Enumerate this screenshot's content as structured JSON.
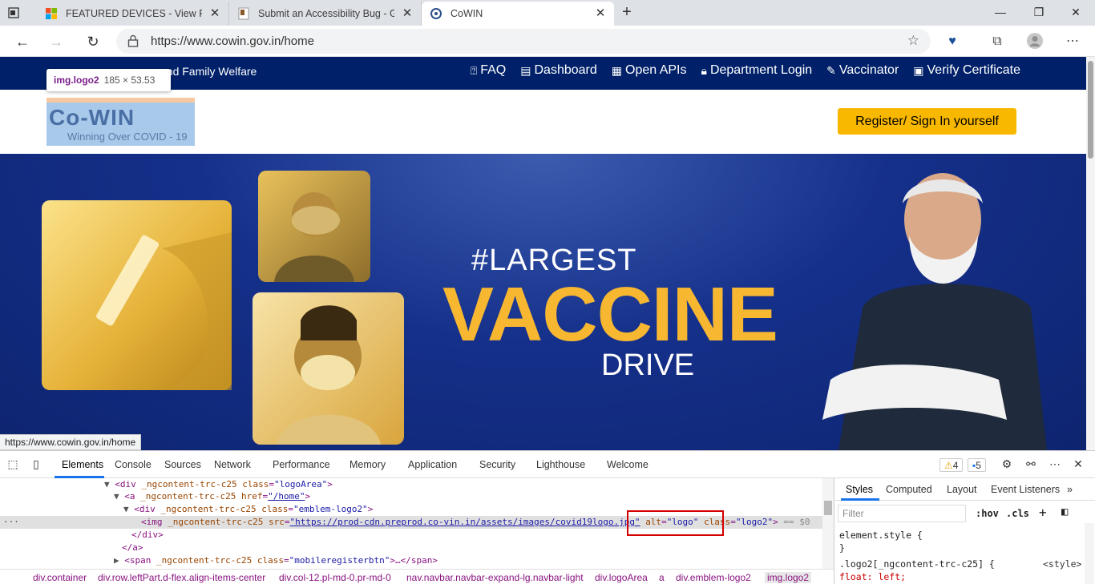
{
  "browser": {
    "tabs": [
      {
        "title": "FEATURED DEVICES - View Prod",
        "active": false
      },
      {
        "title": "Submit an Accessibility Bug - Glo",
        "active": false
      },
      {
        "title": "CoWIN",
        "active": true
      }
    ],
    "url": "https://www.cowin.gov.in/home",
    "status_url": "https://www.cowin.gov.in/home"
  },
  "site": {
    "ministry": "and Family Welfare",
    "nav": [
      {
        "icon": "faq-icon",
        "label": "FAQ"
      },
      {
        "icon": "dashboard-icon",
        "label": "Dashboard"
      },
      {
        "icon": "api-icon",
        "label": "Open APIs"
      },
      {
        "icon": "lock-icon",
        "label": "Department Login"
      },
      {
        "icon": "syringe-icon",
        "label": "Vaccinator"
      },
      {
        "icon": "certificate-icon",
        "label": "Verify Certificate"
      }
    ],
    "logo_title": "Co-WIN",
    "logo_subtitle": "Winning Over COVID - 19",
    "tooltip_tag": "img.logo2",
    "tooltip_dims": "185 × 53.53",
    "register_label": "Register/ Sign In yourself",
    "banner": {
      "hash": "#LARGEST",
      "vaccine": "VACCINE",
      "drive": "DRIVE"
    }
  },
  "devtools": {
    "tabs": [
      "Elements",
      "Console",
      "Sources",
      "Network",
      "Performance",
      "Memory",
      "Application",
      "Security",
      "Lighthouse",
      "Welcome"
    ],
    "warnings": "4",
    "messages": "5",
    "code_lines": [
      {
        "indent": "▼",
        "text": "<div _ngcontent-trc-c25 class=\"logoArea\">"
      },
      {
        "indent": "▼",
        "text": "<a _ngcontent-trc-c25 href=\"/home\">"
      },
      {
        "indent": "▼",
        "text": "<div _ngcontent-trc-c25 class=\"emblem-logo2\">"
      },
      {
        "indent": "",
        "text": "<img _ngcontent-trc-c25 src=\"https://prod-cdn.preprod.co-vin.in/assets/images/covid19logo.jpg\" alt=\"logo\" class=\"logo2\"> == $0"
      },
      {
        "indent": "",
        "text": "</div>"
      },
      {
        "indent": "",
        "text": "</a>"
      },
      {
        "indent": "▶",
        "text": "<span _ngcontent-trc-c25 class=\"mobileregisterbtn\">…</span>"
      }
    ],
    "breadcrumbs": [
      "div.container",
      "div.row.leftPart.d-flex.align-items-center",
      "div.col-12.pl-md-0.pr-md-0",
      "nav.navbar.navbar-expand-lg.navbar-light",
      "div.logoArea",
      "a",
      "div.emblem-logo2",
      "img.logo2"
    ],
    "styles_tabs": [
      "Styles",
      "Computed",
      "Layout",
      "Event Listeners"
    ],
    "filter_placeholder": "Filter",
    "hov": ":hov",
    "cls": ".cls",
    "rules": [
      {
        "selector": "element.style {",
        "source": ""
      },
      {
        "selector": "}",
        "source": ""
      },
      {
        "selector": ".logo2[_ngcontent-trc-c25] {",
        "source": "<style>"
      },
      {
        "selector": "  float: left;",
        "source": ""
      }
    ]
  }
}
